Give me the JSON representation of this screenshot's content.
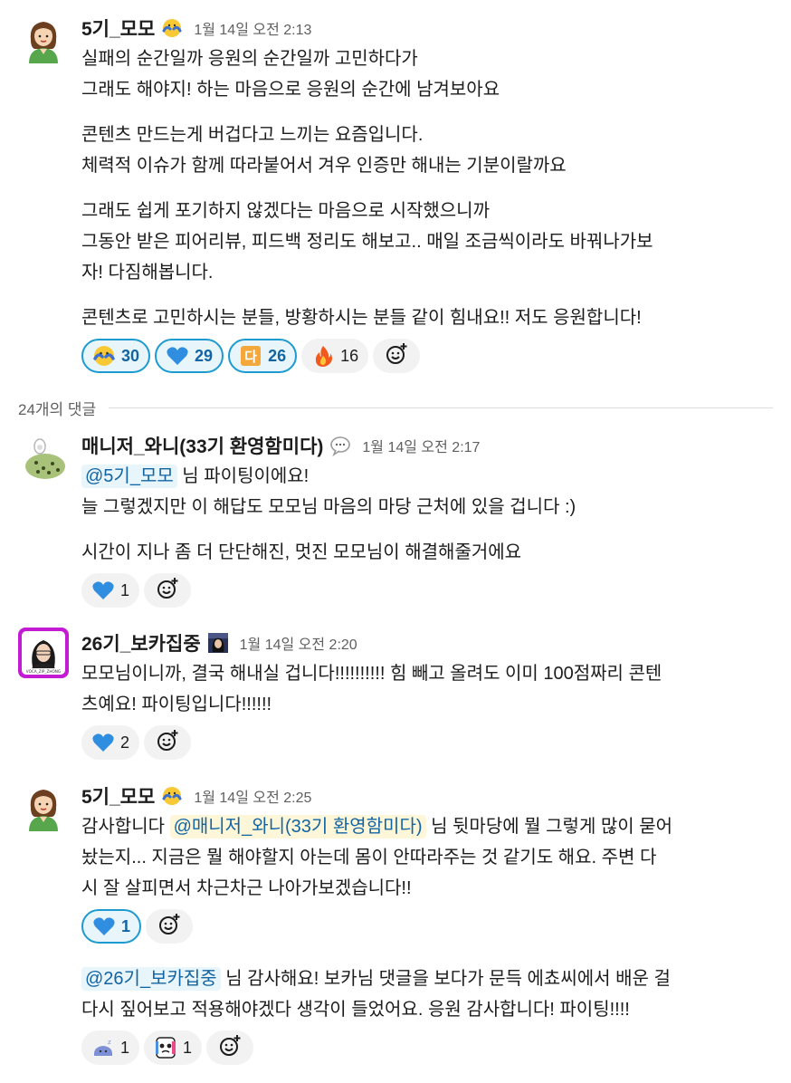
{
  "thread": {
    "parent": {
      "author": "5기_모모",
      "time": "1월 14일 오전 2:13",
      "paragraphs": [
        [
          "실패의 순간일까 응원의 순간일까 고민하다가",
          "그래도 해야지! 하는 마음으로 응원의 순간에 남겨보아요"
        ],
        [
          "콘텐츠 만드는게 버겁다고 느끼는 요즘입니다.",
          "체력적 이슈가 함께 따라붙어서 겨우 인증만 해내는 기분이랄까요"
        ],
        [
          "그래도 쉽게 포기하지 않겠다는 마음으로 시작했으니까",
          "그동안 받은 피어리뷰, 피드백 정리도 해보고.. 매일 조금씩이라도 바꿔나가보",
          "자! 다짐해봅니다."
        ],
        [
          "콘텐츠로 고민하시는 분들, 방황하시는 분들 같이 힘내요!! 저도 응원합니다!"
        ]
      ],
      "reactions": [
        {
          "icon": "hug-face-emoji",
          "count": "30",
          "active": true
        },
        {
          "icon": "blue-heart-emoji",
          "count": "29",
          "active": true
        },
        {
          "icon": "da-letter-emoji",
          "count": "26",
          "active": true
        },
        {
          "icon": "fire-emoji",
          "count": "16",
          "active": false
        }
      ]
    },
    "reply_count_label": "24개의 댓글",
    "replies": [
      {
        "author": "매니저_와니(33기 환영함미다)",
        "time": "1월 14일 오전 2:17",
        "mention": "@5기_모모",
        "line1_rest": " 님 파이팅이에요!",
        "line2": "늘 그렇겠지만 이 해답도 모모님 마음의 마당 근처에 있을 겁니다 :)",
        "line3": "시간이 지나 좀 더 단단해진, 멋진 모모님이 해결해줄거에요",
        "reaction_count": "1"
      },
      {
        "author": "26기_보카집중",
        "time": "1월 14일 오전 2:20",
        "avatar_caption": "VOCA_ZIP_ZHONG",
        "lines": [
          "모모님이니까, 결국 해내실 겁니다!!!!!!!!!! 힘 빼고 올려도 이미 100점짜리 콘텐",
          "츠예요! 파이팅입니다!!!!!!"
        ],
        "reaction_count": "2"
      },
      {
        "author": "5기_모모",
        "time": "1월 14일 오전 2:25",
        "p1_start": "감사합니다 ",
        "p1_mention": "@매니저_와니(33기 환영함미다)",
        "p1_rest": " 님 뒷마당에 뭘 그렇게 많이 묻어",
        "p1_lines": [
          "놨는지... 지금은 뭘 해야할지 아는데 몸이 안따라주는 것 같기도 해요. 주변 다",
          "시 잘 살피면서 차근차근 나아가보겠습니다!!"
        ],
        "reaction_count": "1",
        "p2_mention": "@26기_보카집중",
        "p2_rest": " 님 감사해요! 보카님 댓글을 보다가 문득 에쵸씨에서 배운 걸",
        "p2_line2": "다시 짚어보고 적용해야겠다 생각이 들었어요. 응원 감사합니다! 파이팅!!!!",
        "p2_reactions": [
          {
            "icon": "sleepy-blob-emoji",
            "count": "1"
          },
          {
            "icon": "crying-cartoon-emoji",
            "count": "1"
          }
        ]
      }
    ]
  },
  "colors": {
    "mention_text": "#1264a3",
    "mention_bg": "#e8f5fa",
    "mention_highlight_bg": "#fef6d8",
    "active_reaction_border": "#1d9bd1"
  }
}
